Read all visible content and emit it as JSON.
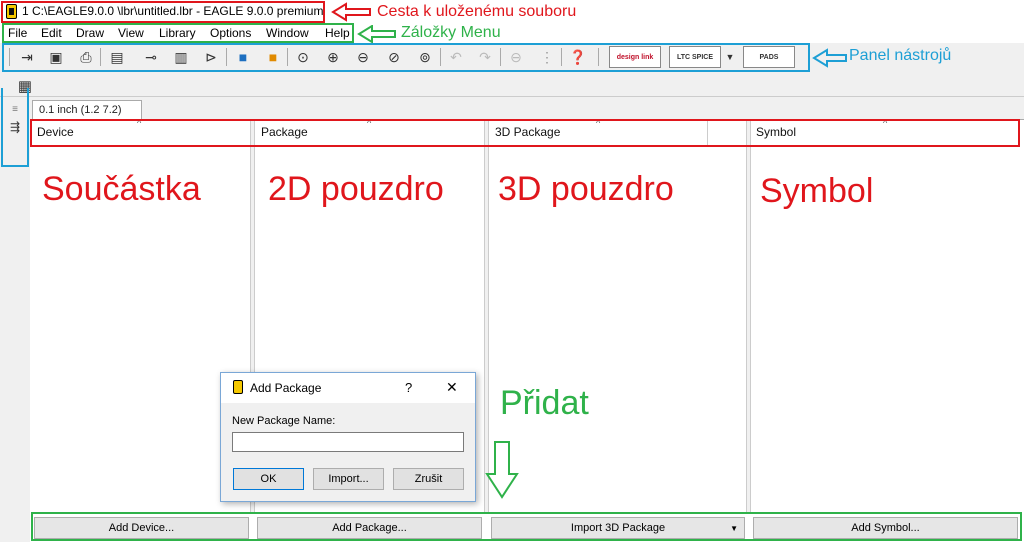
{
  "window": {
    "title": "1 C:\\EAGLE9.0.0 \\lbr\\untitled.lbr - EAGLE 9.0.0 premium"
  },
  "menu": [
    "File",
    "Edit",
    "Draw",
    "View",
    "Library",
    "Options",
    "Window",
    "Help"
  ],
  "annotations": {
    "path": "Cesta k uloženému souboru",
    "menu": "Záložky Menu",
    "toolbar": "Panel nástrojů",
    "add": "Přidat"
  },
  "toolbar": {
    "design_link": "design link",
    "ltc_spice": "LTC SPICE",
    "pads": "PADS"
  },
  "grid": {
    "label": "0.1 inch (1.2 7.2)"
  },
  "columns": {
    "device": "Device",
    "package": "Package",
    "package3d": "3D Package",
    "symbol": "Symbol"
  },
  "column_labels_cz": {
    "device": "Součástka",
    "package": "2D pouzdro",
    "package3d": "3D pouzdro",
    "symbol": "Symbol"
  },
  "buttons": {
    "add_device": "Add Device...",
    "add_package": "Add Package...",
    "import_3d": "Import 3D Package",
    "add_symbol": "Add Symbol..."
  },
  "dialog": {
    "title": "Add Package",
    "help": "?",
    "close": "✕",
    "field_label": "New Package Name:",
    "field_value": "",
    "ok": "OK",
    "import": "Import...",
    "cancel": "Zrušit"
  }
}
